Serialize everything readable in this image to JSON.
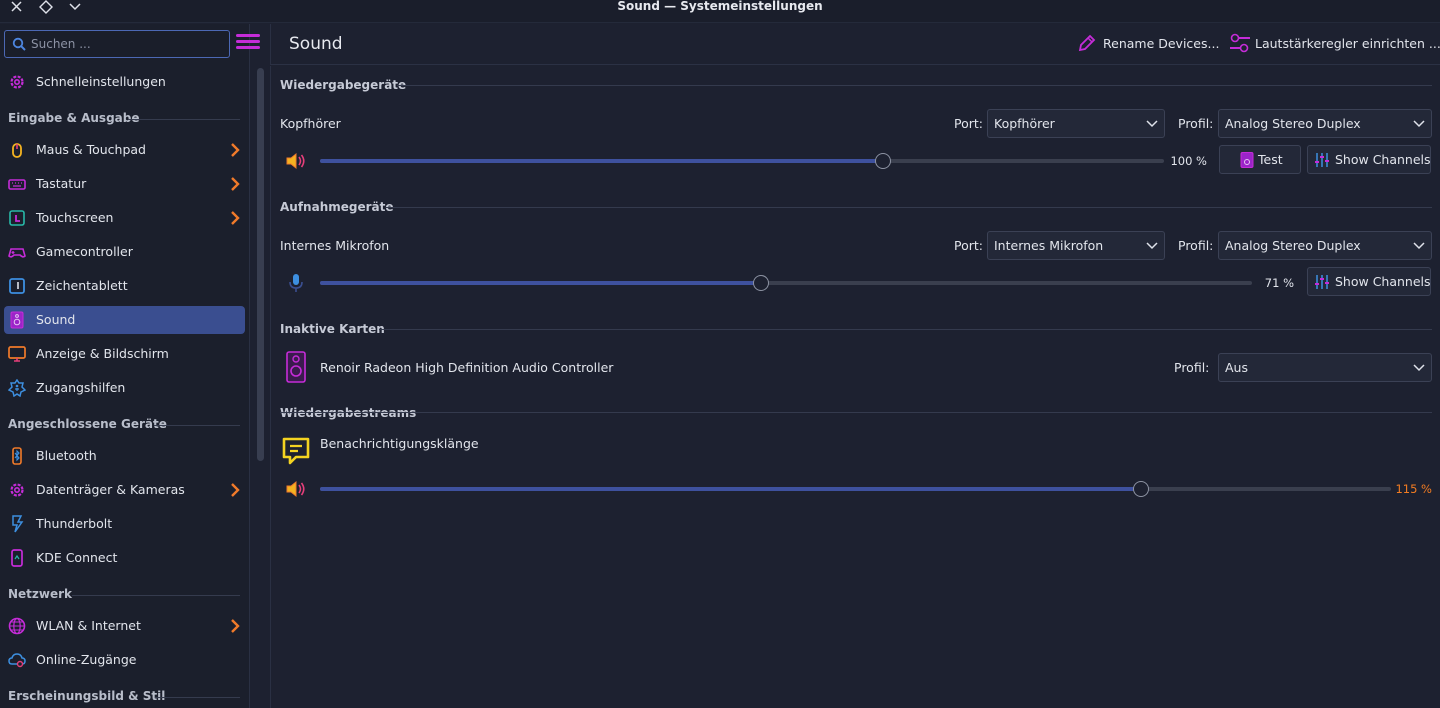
{
  "window": {
    "title": "Sound — Systemeinstellungen"
  },
  "search": {
    "placeholder": "Suchen ..."
  },
  "sidebar": {
    "quick": "Schnelleinstellungen",
    "cat_io": "Eingabe & Ausgabe",
    "maus": "Maus & Touchpad",
    "tastatur": "Tastatur",
    "touchscreen": "Touchscreen",
    "gamecontroller": "Gamecontroller",
    "zeichentablett": "Zeichentablett",
    "sound": "Sound",
    "anzeige": "Anzeige & Bildschirm",
    "zugang": "Zugangshilfen",
    "cat_devices": "Angeschlossene Geräte",
    "bluetooth": "Bluetooth",
    "datentraeger": "Datenträger & Kameras",
    "thunderbolt": "Thunderbolt",
    "kdeconnect": "KDE Connect",
    "cat_net": "Netzwerk",
    "wlan": "WLAN & Internet",
    "online": "Online-Zugänge",
    "cat_look": "Erscheinungsbild & Stil"
  },
  "header": {
    "title": "Sound",
    "rename": "Rename Devices...",
    "volume_setup": "Lautstärkeregler einrichten ..."
  },
  "playback": {
    "section": "Wiedergabegeräte",
    "device": "Kopfhörer",
    "port_label": "Port:",
    "port_value": "Kopfhörer",
    "profile_label": "Profil:",
    "profile_value": "Analog Stereo Duplex",
    "volume_percent": 100,
    "volume_text": "100 %",
    "test": "Test",
    "show_channels": "Show Channels"
  },
  "capture": {
    "section": "Aufnahmegeräte",
    "device": "Internes Mikrofon",
    "port_label": "Port:",
    "port_value": "Internes Mikrofon",
    "profile_label": "Profil:",
    "profile_value": "Analog Stereo Duplex",
    "volume_percent": 71,
    "volume_text": "71 %",
    "show_channels": "Show Channels"
  },
  "inactive": {
    "section": "Inaktive Karten",
    "card": "Renoir Radeon High Definition Audio Controller",
    "profile_label": "Profil:",
    "profile_value": "Aus"
  },
  "streams": {
    "section": "Wiedergabestreams",
    "name": "Benachrichtigungsklänge",
    "volume_percent": 115,
    "volume_text": "115 %"
  },
  "colors": {
    "accent": "#3e519e",
    "highlight": "#3a4e90",
    "over_amplified": "#f27c22",
    "icon_magenta": "#c52cd8",
    "chevron_orange": "#f07a2a"
  }
}
